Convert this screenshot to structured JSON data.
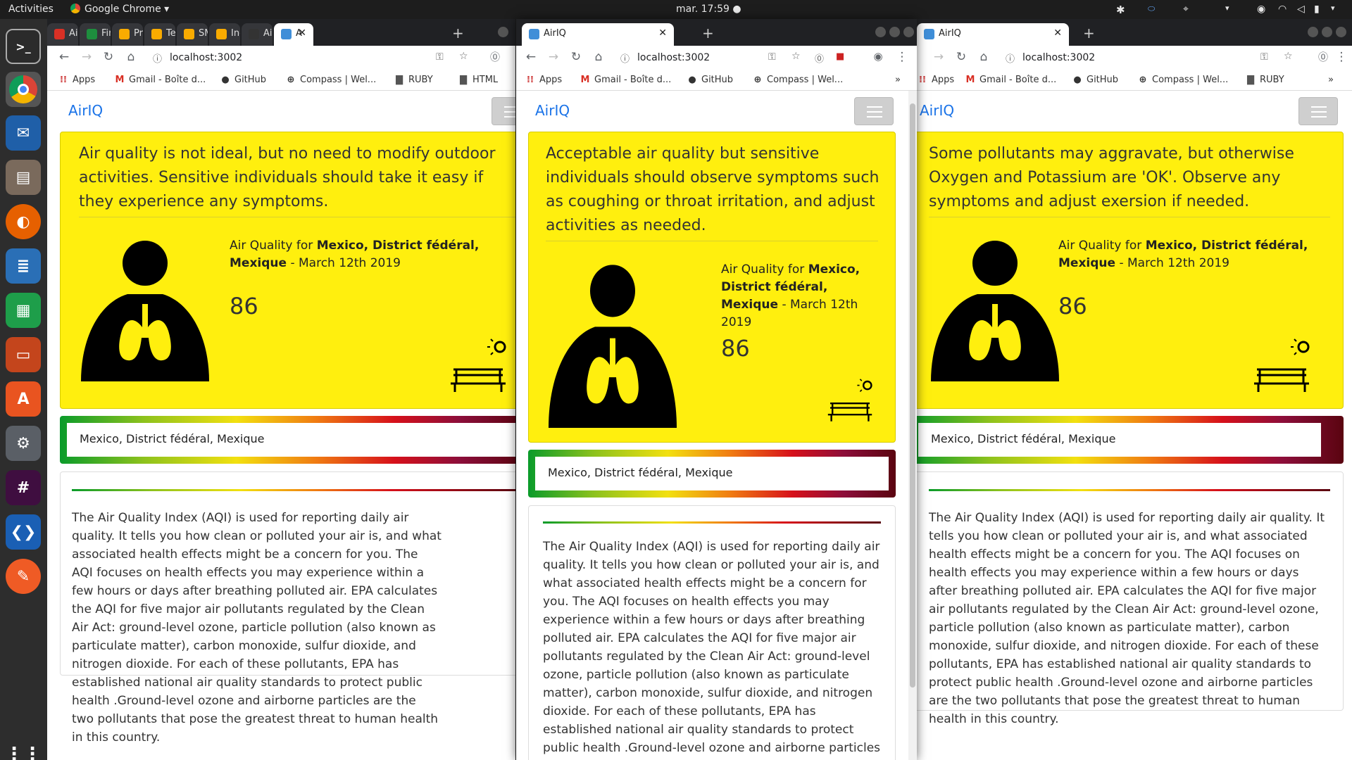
{
  "os": {
    "activities": "Activities",
    "app_name": "Google Chrome",
    "clock": "mar. 17:59"
  },
  "dock": {
    "items": [
      "terminal",
      "chrome",
      "thunderbird",
      "files",
      "firefox",
      "writer",
      "calc",
      "impress",
      "software-center",
      "settings",
      "slack",
      "vscode",
      "postman",
      "show-apps"
    ]
  },
  "browser_left": {
    "tabs": [
      {
        "label": "AirV",
        "fav": "#d93025",
        "icon": "swiss-flag-icon"
      },
      {
        "label": "Fina",
        "fav": "#1e8e3e",
        "icon": "plus-square-icon"
      },
      {
        "label": "Proj",
        "fav": "#f9ab00",
        "icon": "doc-icon"
      },
      {
        "label": "Tech",
        "fav": "#f9ab00",
        "icon": "doc-icon"
      },
      {
        "label": "SMS",
        "fav": "#f9ab00",
        "icon": "doc-icon"
      },
      {
        "label": "Inde",
        "fav": "#f9ab00",
        "icon": "doc-icon"
      },
      {
        "label": "Air",
        "fav": "#333",
        "icon": "usepa-icon"
      },
      {
        "label": "A",
        "fav": "#3f8ed8",
        "icon": "airiq-icon",
        "active": true
      }
    ],
    "url": "localhost:3002",
    "bookmarks": [
      "Apps",
      "Gmail - Boîte d...",
      "GitHub",
      "Compass | Wel...",
      "RUBY",
      "HTML"
    ]
  },
  "browser_center": {
    "tab_title": "AirIQ",
    "url": "localhost:3002",
    "bookmarks": [
      "Apps",
      "Gmail - Boîte d...",
      "GitHub",
      "Compass | Wel..."
    ],
    "more": "»"
  },
  "browser_right": {
    "tab_title": "AirIQ",
    "url": "localhost:3002",
    "bookmarks": [
      "Apps",
      "Gmail - Boîte d...",
      "GitHub",
      "Compass | Wel...",
      "RUBY"
    ],
    "more": "»"
  },
  "app": {
    "brand": "AirIQ",
    "aq_prefix": "Air Quality for ",
    "location": "Mexico, District fédéral, Mexique",
    "date_suffix": " - March 12th 2019",
    "aqi": "86",
    "aqi_color": "#ffef0e",
    "left_lead": "Air quality is not ideal, but no need to modify outdoor activities. Sensitive individuals should take it easy if they experience any symptoms.",
    "center_lead": "Acceptable air quality but sensitive individuals should observe symptoms such as coughing or throat irritation, and adjust activities as needed.",
    "right_lead": "Some pollutants may aggravate, but otherwise Oxygen and Potassium are 'OK'. Observe any symptoms and adjust exersion if needed.",
    "description": "The Air Quality Index (AQI) is used for reporting daily air quality. It tells you how clean or polluted your air is, and what associated health effects might be a concern for you. The AQI focuses on health effects you may experience within a few hours or days after breathing polluted air. EPA calculates the AQI for five major air pollutants regulated by the Clean Air Act: ground-level ozone, particle pollution (also known as particulate matter), carbon monoxide, sulfur dioxide, and nitrogen dioxide. For each of these pollutants, EPA has established national air quality standards to protect public health .Ground-level ozone and airborne particles are the two pollutants that pose the greatest threat to human health in this country."
  }
}
